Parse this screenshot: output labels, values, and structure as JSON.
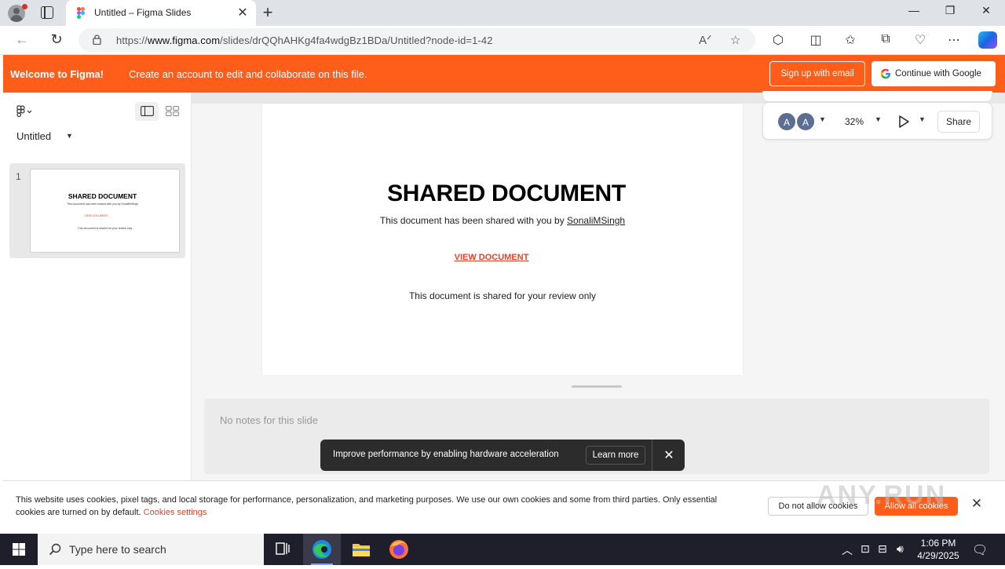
{
  "browser": {
    "tab_title": "Untitled – Figma Slides",
    "url_prefix": "https://",
    "url_domain": "www.figma.com",
    "url_path": "/slides/drQQhAHKg4fa4wdgBz1BDa/Untitled?node-id=1-42",
    "window_controls": {
      "minimize": "—",
      "restore": "❐",
      "close": "✕"
    },
    "new_tab": "+",
    "tab_close": "✕"
  },
  "banner": {
    "welcome": "Welcome to Figma!",
    "message": "Create an account to edit and collaborate on this file.",
    "signup": "Sign up with email",
    "google": "Continue with Google"
  },
  "left_panel": {
    "file_name": "Untitled",
    "slides": [
      {
        "number": "1",
        "thumb_title": "SHARED DOCUMENT",
        "thumb_sub": "This document has been shared with you by SonaliMSingh",
        "thumb_link": "VIEW DOCUMENT",
        "thumb_note": "This document is shared for your review only"
      }
    ]
  },
  "toolbar": {
    "avatars": [
      "A",
      "A"
    ],
    "zoom": "32%",
    "share": "Share"
  },
  "slide": {
    "title": "SHARED DOCUMENT",
    "subtitle_prefix": "This document has been shared with you by ",
    "subtitle_user": "SonaliMSingh",
    "link": "VIEW DOCUMENT",
    "note": "This document is shared for your review only"
  },
  "notes": {
    "placeholder": "No notes for this slide"
  },
  "toast": {
    "message": "Improve performance by enabling hardware acceleration",
    "learn_more": "Learn more"
  },
  "cookie_bar": {
    "text": "This website uses cookies, pixel tags, and local storage for performance, personalization, and marketing purposes. We use our own cookies and some from third parties. Only essential cookies are turned on by default.",
    "settings_link": "Cookies settings",
    "deny": "Do not allow cookies",
    "allow": "Allow all cookies"
  },
  "watermark": "ANY.RUN",
  "taskbar": {
    "search_placeholder": "Type here to search",
    "time": "1:06 PM",
    "date": "4/29/2025"
  },
  "colors": {
    "figma_orange": "#ff5e1a",
    "link_red": "#e0442d",
    "taskbar": "#1f1f2b"
  }
}
